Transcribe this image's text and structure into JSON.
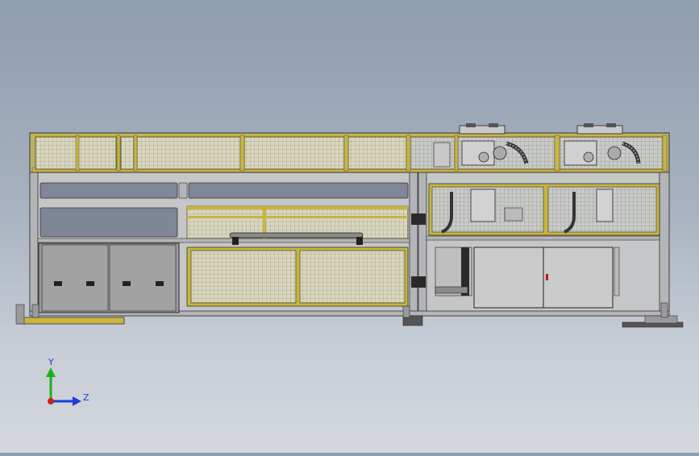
{
  "app": {
    "kind": "CAD front view of machine assembly"
  },
  "triad": {
    "y_label": "Y",
    "z_label": "Z",
    "colors": {
      "y_axis": "#19b319",
      "z_axis": "#1a3fd6",
      "x_axis": "#d02020"
    }
  },
  "colors": {
    "frame_yellow": "#c8b43a",
    "frame_grey": "#b7b9bd",
    "mesh_panel": "#d8d6b6",
    "cabinet_grey": "#9a9a9a",
    "cabinet_light": "#c9c9c9",
    "dark": "#2a2a2a",
    "window_blue": "#7f8698"
  }
}
